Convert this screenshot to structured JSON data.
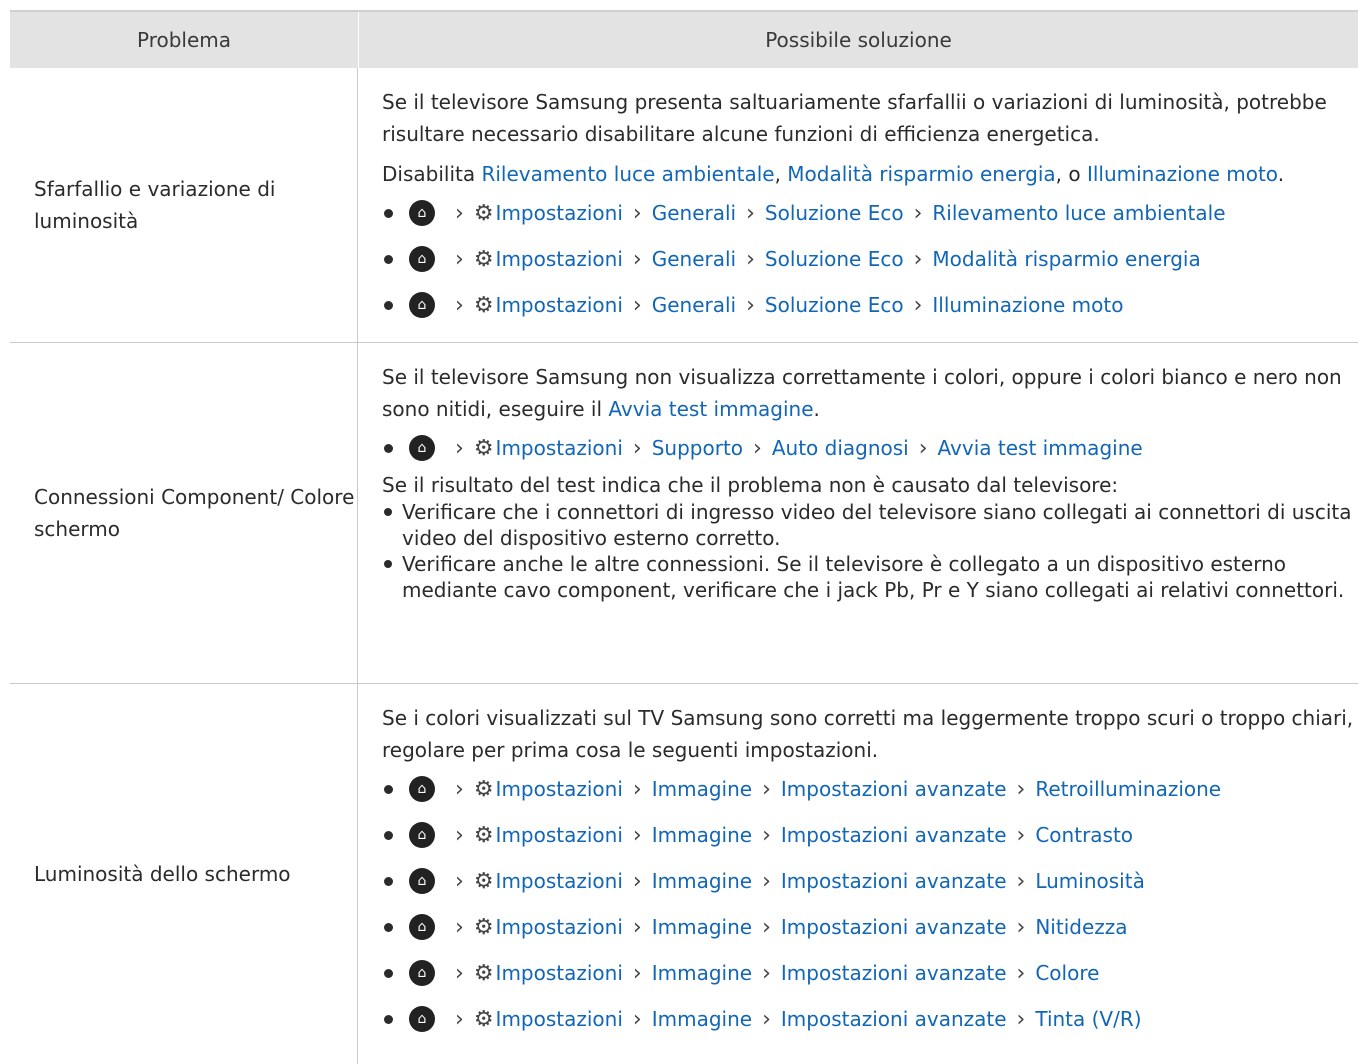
{
  "header": {
    "col1": "Problema",
    "col2": "Possibile soluzione"
  },
  "rows": [
    {
      "problem": "Sfarfallio e variazione di luminosità",
      "intro": "Se il televisore Samsung presenta saltuariamente sfarfallii o variazioni di luminosità, potrebbe risultare necessario disabilitare alcune funzioni di efficienza energetica.",
      "disable_prefix": "Disabilita ",
      "disable_links": [
        "Rilevamento luce ambientale",
        "Modalità risparmio energia",
        "Illuminazione moto"
      ],
      "sep1": ", ",
      "sep2": ", o ",
      "end": ".",
      "paths": [
        [
          "Impostazioni",
          "Generali",
          "Soluzione Eco",
          "Rilevamento luce ambientale"
        ],
        [
          "Impostazioni",
          "Generali",
          "Soluzione Eco",
          "Modalità risparmio energia"
        ],
        [
          "Impostazioni",
          "Generali",
          "Soluzione Eco",
          "Illuminazione moto"
        ]
      ]
    },
    {
      "problem": "Connessioni Component/ Colore schermo",
      "intro_prefix": "Se il televisore Samsung non visualizza correttamente i colori, oppure i colori bianco e nero non sono nitidi, eseguire il ",
      "intro_link": "Avvia test immagine",
      "end": ".",
      "paths": [
        [
          "Impostazioni",
          "Supporto",
          "Auto diagnosi",
          "Avvia test immagine"
        ]
      ],
      "result_text": "Se il risultato del test indica che il problema non è causato dal televisore:",
      "bullets": [
        "Verificare che i connettori di ingresso video del televisore siano collegati ai connettori di uscita video del dispositivo esterno corretto.",
        "Verificare anche le altre connessioni. Se il televisore è collegato a un dispositivo esterno mediante cavo component, verificare che i jack Pb, Pr e Y siano collegati ai relativi connettori."
      ]
    },
    {
      "problem": "Luminosità dello schermo",
      "intro": "Se i colori visualizzati sul TV Samsung sono corretti ma leggermente troppo scuri o troppo chiari, regolare per prima cosa le seguenti impostazioni.",
      "paths": [
        [
          "Impostazioni",
          "Immagine",
          "Impostazioni avanzate",
          "Retroilluminazione"
        ],
        [
          "Impostazioni",
          "Immagine",
          "Impostazioni avanzate",
          "Contrasto"
        ],
        [
          "Impostazioni",
          "Immagine",
          "Impostazioni avanzate",
          "Luminosità"
        ],
        [
          "Impostazioni",
          "Immagine",
          "Impostazioni avanzate",
          "Nitidezza"
        ],
        [
          "Impostazioni",
          "Immagine",
          "Impostazioni avanzate",
          "Colore"
        ],
        [
          "Impostazioni",
          "Immagine",
          "Impostazioni avanzate",
          "Tinta (V/R)"
        ]
      ]
    }
  ],
  "icons": {
    "home": "home-icon",
    "settings": "gear-icon",
    "chevron": "chevron-right-icon"
  },
  "colors": {
    "link": "#1266b6",
    "header_bg": "#e3e3e3",
    "text": "#2b2b2b"
  }
}
